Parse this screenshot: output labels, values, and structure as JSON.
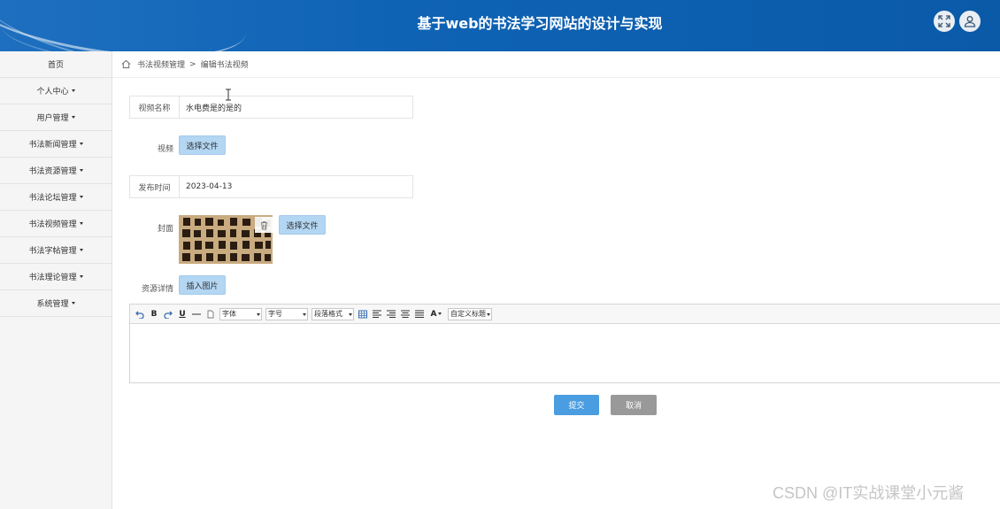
{
  "header": {
    "title": "基于web的书法学习网站的设计与实现",
    "icons": [
      "fullscreen-icon",
      "user-icon"
    ],
    "colors": {
      "bar": "#0f63b5"
    }
  },
  "sidebar": {
    "items": [
      {
        "label": "首页",
        "dropdown": false
      },
      {
        "label": "个人中心",
        "dropdown": true
      },
      {
        "label": "用户管理",
        "dropdown": true
      },
      {
        "label": "书法新闻管理",
        "dropdown": true
      },
      {
        "label": "书法资源管理",
        "dropdown": true
      },
      {
        "label": "书法论坛管理",
        "dropdown": true
      },
      {
        "label": "书法视频管理",
        "dropdown": true
      },
      {
        "label": "书法字帖管理",
        "dropdown": true
      },
      {
        "label": "书法理论管理",
        "dropdown": true
      },
      {
        "label": "系统管理",
        "dropdown": true
      }
    ]
  },
  "breadcrumb": {
    "parent": "书法视频管理",
    "separator": ">",
    "current": "编辑书法视频"
  },
  "form": {
    "video_name": {
      "label": "视频名称",
      "value": "水电费是的是的"
    },
    "video": {
      "label": "视频",
      "button": "选择文件"
    },
    "publish_time": {
      "label": "发布时间",
      "value": "2023-04-13"
    },
    "cover": {
      "label": "封面",
      "button": "选择文件"
    },
    "detail": {
      "label": "资源详情",
      "insert_button": "插入图片"
    }
  },
  "editor": {
    "font_select": "字体",
    "size_select": "字号",
    "paragraph_select": "段落格式",
    "custom_title_select": "自定义标题",
    "bold": "B",
    "underline": "U",
    "font_color": "A"
  },
  "actions": {
    "submit": "提交",
    "cancel": "取消",
    "colors": {
      "submit": "#4a9de0",
      "cancel": "#999999"
    }
  },
  "watermark": "CSDN @IT实战课堂小元酱"
}
